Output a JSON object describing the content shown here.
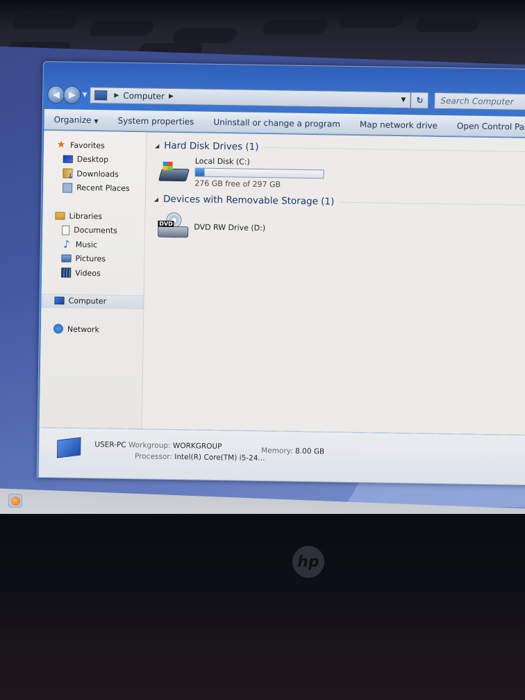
{
  "window": {
    "address": {
      "breadcrumb": [
        "Computer"
      ],
      "search_placeholder": "Search Computer"
    },
    "toolbar": {
      "organize": "Organize",
      "system_properties": "System properties",
      "uninstall": "Uninstall or change a program",
      "map_network_drive": "Map network drive",
      "open_control_panel": "Open Control Panel"
    },
    "nav_pane": {
      "favorites": {
        "label": "Favorites",
        "items": [
          "Desktop",
          "Downloads",
          "Recent Places"
        ]
      },
      "libraries": {
        "label": "Libraries",
        "items": [
          "Documents",
          "Music",
          "Pictures",
          "Videos"
        ]
      },
      "computer": "Computer",
      "network": "Network"
    },
    "groups": [
      {
        "title": "Hard Disk Drives (1)",
        "drives": [
          {
            "name": "Local Disk (C:)",
            "free_text": "276 GB free of 297 GB",
            "used_fraction": 0.07
          }
        ]
      },
      {
        "title": "Devices with Removable Storage (1)",
        "drives": [
          {
            "name": "DVD RW Drive (D:)",
            "badge": "DVD"
          }
        ]
      }
    ],
    "details": {
      "computer_name": "USER-PC",
      "workgroup_label": "Workgroup:",
      "workgroup_value": "WORKGROUP",
      "memory_label": "Memory:",
      "memory_value": "8.00 GB",
      "processor_label": "Processor:",
      "processor_value": "Intel(R) Core(TM) i5-24..."
    }
  },
  "hardware": {
    "logo": "hp"
  }
}
